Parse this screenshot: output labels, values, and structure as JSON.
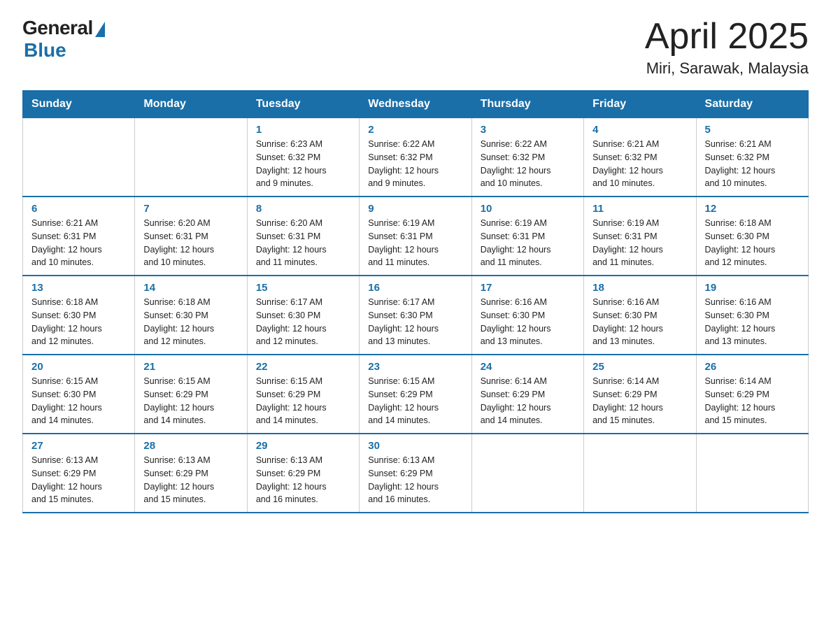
{
  "logo": {
    "general": "General",
    "blue": "Blue"
  },
  "title": "April 2025",
  "subtitle": "Miri, Sarawak, Malaysia",
  "days_of_week": [
    "Sunday",
    "Monday",
    "Tuesday",
    "Wednesday",
    "Thursday",
    "Friday",
    "Saturday"
  ],
  "weeks": [
    [
      {
        "day": "",
        "info": ""
      },
      {
        "day": "",
        "info": ""
      },
      {
        "day": "1",
        "info": "Sunrise: 6:23 AM\nSunset: 6:32 PM\nDaylight: 12 hours\nand 9 minutes."
      },
      {
        "day": "2",
        "info": "Sunrise: 6:22 AM\nSunset: 6:32 PM\nDaylight: 12 hours\nand 9 minutes."
      },
      {
        "day": "3",
        "info": "Sunrise: 6:22 AM\nSunset: 6:32 PM\nDaylight: 12 hours\nand 10 minutes."
      },
      {
        "day": "4",
        "info": "Sunrise: 6:21 AM\nSunset: 6:32 PM\nDaylight: 12 hours\nand 10 minutes."
      },
      {
        "day": "5",
        "info": "Sunrise: 6:21 AM\nSunset: 6:32 PM\nDaylight: 12 hours\nand 10 minutes."
      }
    ],
    [
      {
        "day": "6",
        "info": "Sunrise: 6:21 AM\nSunset: 6:31 PM\nDaylight: 12 hours\nand 10 minutes."
      },
      {
        "day": "7",
        "info": "Sunrise: 6:20 AM\nSunset: 6:31 PM\nDaylight: 12 hours\nand 10 minutes."
      },
      {
        "day": "8",
        "info": "Sunrise: 6:20 AM\nSunset: 6:31 PM\nDaylight: 12 hours\nand 11 minutes."
      },
      {
        "day": "9",
        "info": "Sunrise: 6:19 AM\nSunset: 6:31 PM\nDaylight: 12 hours\nand 11 minutes."
      },
      {
        "day": "10",
        "info": "Sunrise: 6:19 AM\nSunset: 6:31 PM\nDaylight: 12 hours\nand 11 minutes."
      },
      {
        "day": "11",
        "info": "Sunrise: 6:19 AM\nSunset: 6:31 PM\nDaylight: 12 hours\nand 11 minutes."
      },
      {
        "day": "12",
        "info": "Sunrise: 6:18 AM\nSunset: 6:30 PM\nDaylight: 12 hours\nand 12 minutes."
      }
    ],
    [
      {
        "day": "13",
        "info": "Sunrise: 6:18 AM\nSunset: 6:30 PM\nDaylight: 12 hours\nand 12 minutes."
      },
      {
        "day": "14",
        "info": "Sunrise: 6:18 AM\nSunset: 6:30 PM\nDaylight: 12 hours\nand 12 minutes."
      },
      {
        "day": "15",
        "info": "Sunrise: 6:17 AM\nSunset: 6:30 PM\nDaylight: 12 hours\nand 12 minutes."
      },
      {
        "day": "16",
        "info": "Sunrise: 6:17 AM\nSunset: 6:30 PM\nDaylight: 12 hours\nand 13 minutes."
      },
      {
        "day": "17",
        "info": "Sunrise: 6:16 AM\nSunset: 6:30 PM\nDaylight: 12 hours\nand 13 minutes."
      },
      {
        "day": "18",
        "info": "Sunrise: 6:16 AM\nSunset: 6:30 PM\nDaylight: 12 hours\nand 13 minutes."
      },
      {
        "day": "19",
        "info": "Sunrise: 6:16 AM\nSunset: 6:30 PM\nDaylight: 12 hours\nand 13 minutes."
      }
    ],
    [
      {
        "day": "20",
        "info": "Sunrise: 6:15 AM\nSunset: 6:30 PM\nDaylight: 12 hours\nand 14 minutes."
      },
      {
        "day": "21",
        "info": "Sunrise: 6:15 AM\nSunset: 6:29 PM\nDaylight: 12 hours\nand 14 minutes."
      },
      {
        "day": "22",
        "info": "Sunrise: 6:15 AM\nSunset: 6:29 PM\nDaylight: 12 hours\nand 14 minutes."
      },
      {
        "day": "23",
        "info": "Sunrise: 6:15 AM\nSunset: 6:29 PM\nDaylight: 12 hours\nand 14 minutes."
      },
      {
        "day": "24",
        "info": "Sunrise: 6:14 AM\nSunset: 6:29 PM\nDaylight: 12 hours\nand 14 minutes."
      },
      {
        "day": "25",
        "info": "Sunrise: 6:14 AM\nSunset: 6:29 PM\nDaylight: 12 hours\nand 15 minutes."
      },
      {
        "day": "26",
        "info": "Sunrise: 6:14 AM\nSunset: 6:29 PM\nDaylight: 12 hours\nand 15 minutes."
      }
    ],
    [
      {
        "day": "27",
        "info": "Sunrise: 6:13 AM\nSunset: 6:29 PM\nDaylight: 12 hours\nand 15 minutes."
      },
      {
        "day": "28",
        "info": "Sunrise: 6:13 AM\nSunset: 6:29 PM\nDaylight: 12 hours\nand 15 minutes."
      },
      {
        "day": "29",
        "info": "Sunrise: 6:13 AM\nSunset: 6:29 PM\nDaylight: 12 hours\nand 16 minutes."
      },
      {
        "day": "30",
        "info": "Sunrise: 6:13 AM\nSunset: 6:29 PM\nDaylight: 12 hours\nand 16 minutes."
      },
      {
        "day": "",
        "info": ""
      },
      {
        "day": "",
        "info": ""
      },
      {
        "day": "",
        "info": ""
      }
    ]
  ]
}
